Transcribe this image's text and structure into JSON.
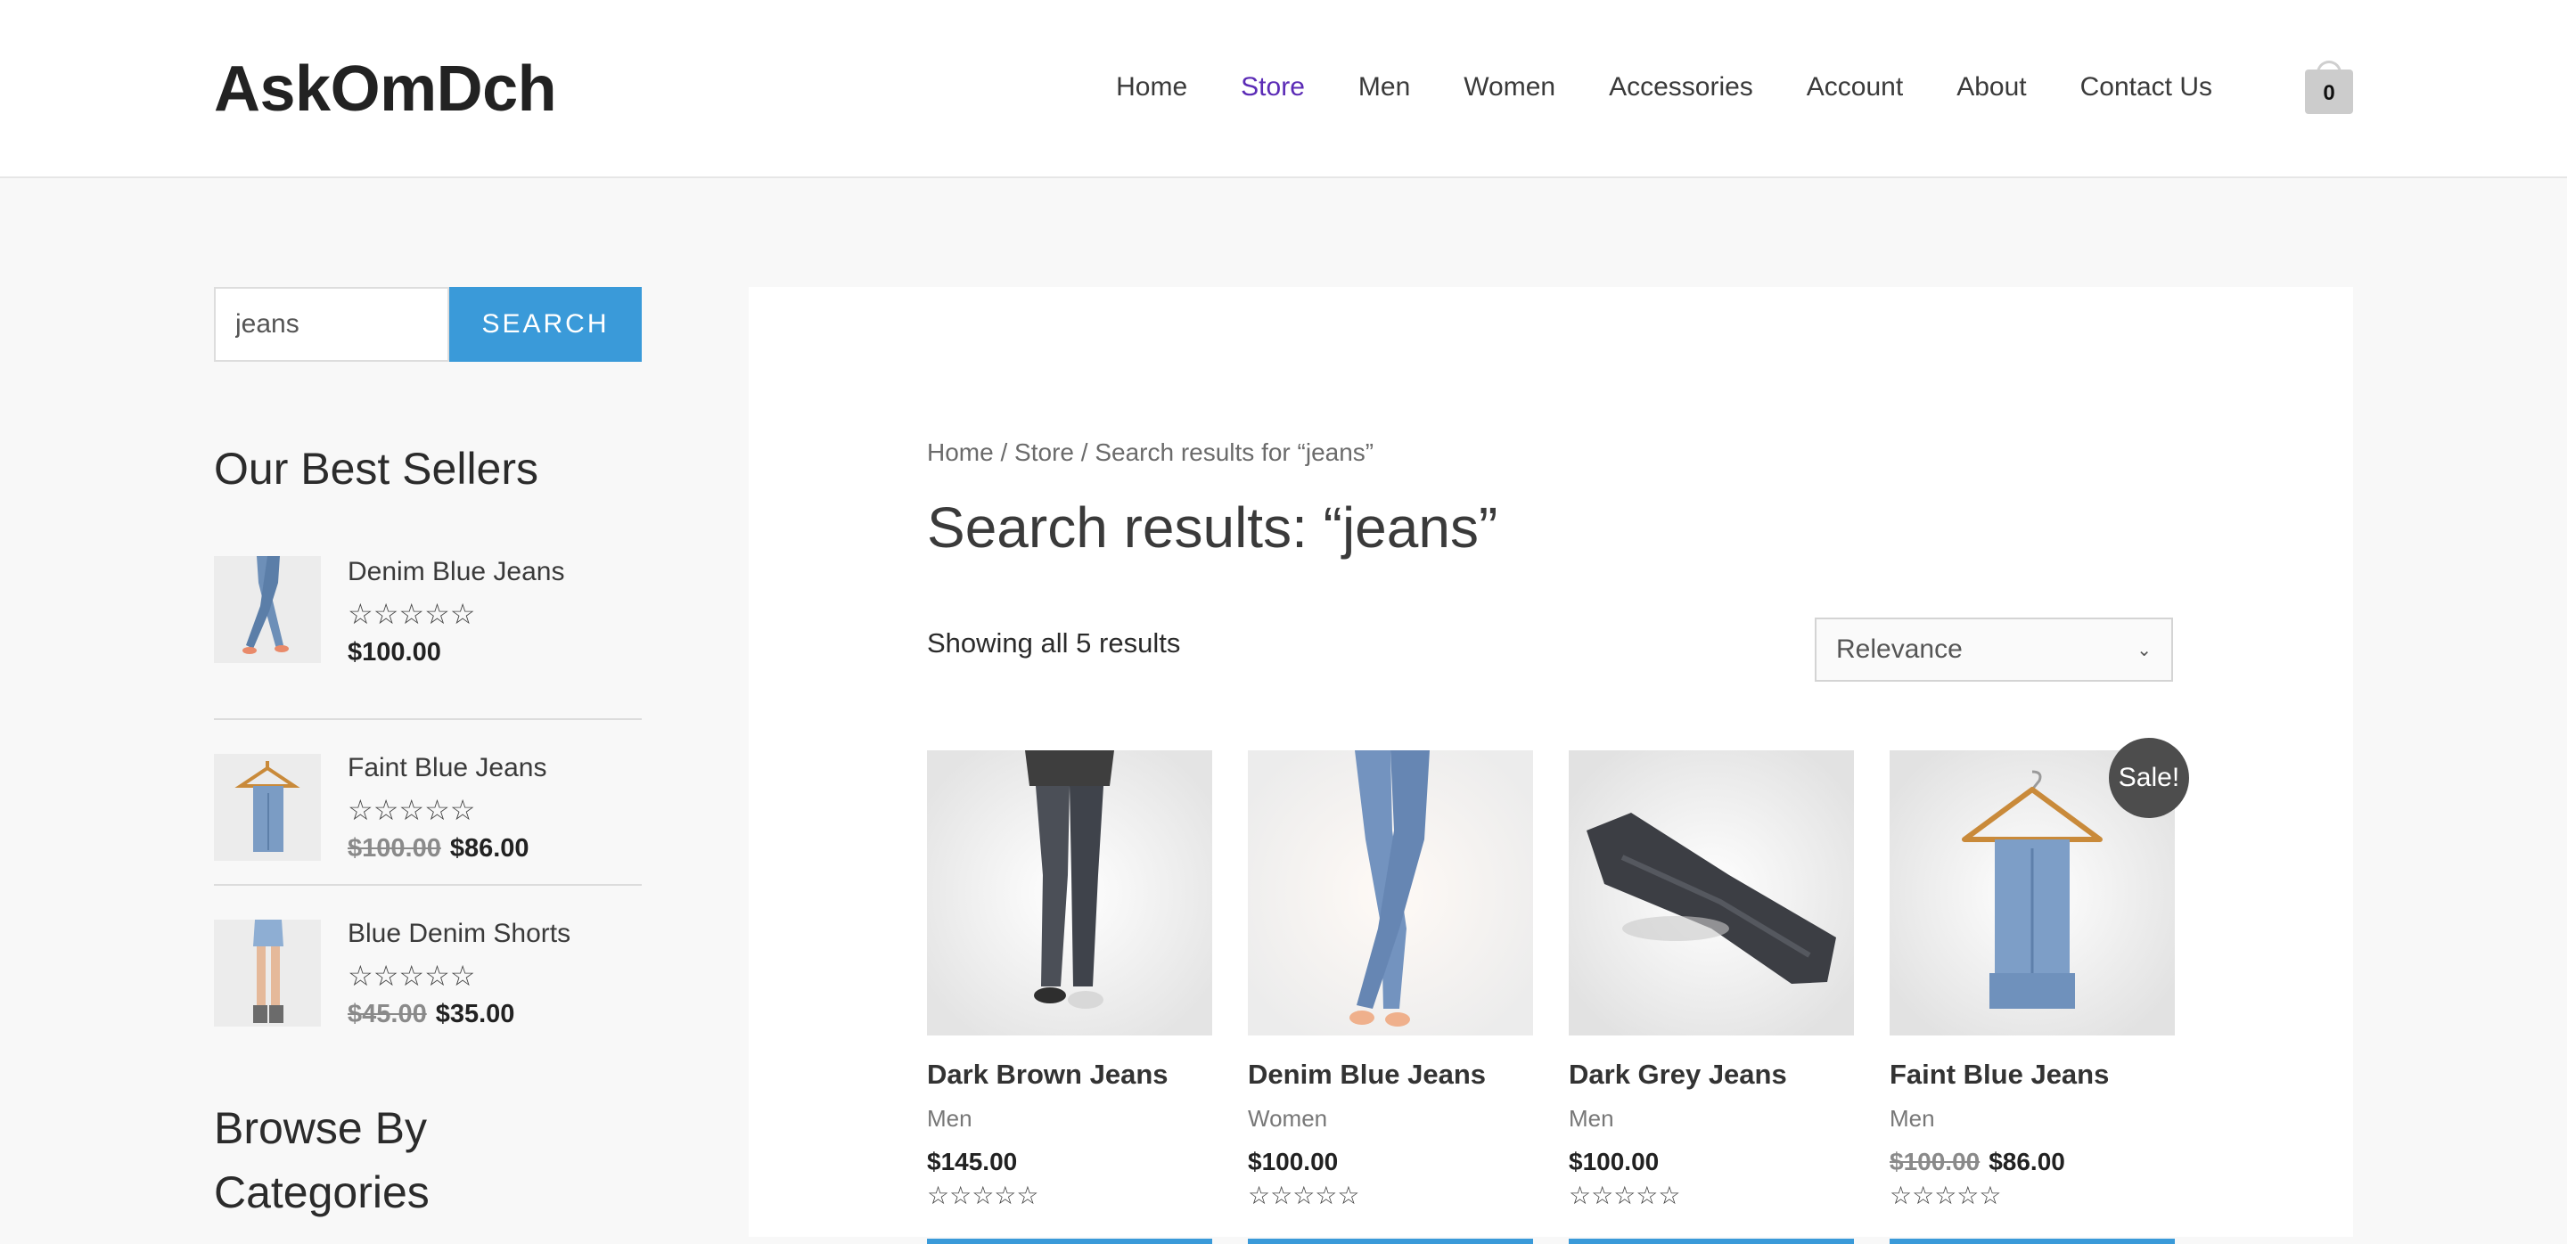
{
  "header": {
    "logo": "AskOmDch",
    "nav": [
      {
        "label": "Home",
        "active": false
      },
      {
        "label": "Store",
        "active": true
      },
      {
        "label": "Men",
        "active": false
      },
      {
        "label": "Women",
        "active": false
      },
      {
        "label": "Accessories",
        "active": false
      },
      {
        "label": "Account",
        "active": false
      },
      {
        "label": "About",
        "active": false
      },
      {
        "label": "Contact Us",
        "active": false
      }
    ],
    "cart_count": "0",
    "cart_icon": "shopping-bag-icon"
  },
  "sidebar": {
    "search": {
      "value": "jeans",
      "button_label": "SEARCH"
    },
    "best_sellers": {
      "title": "Our Best Sellers",
      "items": [
        {
          "name": "Denim Blue Jeans",
          "stars": "☆☆☆☆☆",
          "old_price": "",
          "price": "$100.00"
        },
        {
          "name": "Faint Blue Jeans",
          "stars": "☆☆☆☆☆",
          "old_price": "$100.00",
          "price": "$86.00"
        },
        {
          "name": "Blue Denim Shorts",
          "stars": "☆☆☆☆☆",
          "old_price": "$45.00",
          "price": "$35.00"
        }
      ]
    },
    "categories": {
      "title_line1": "Browse By",
      "title_line2": "Categories"
    }
  },
  "main": {
    "breadcrumb": {
      "home": "Home",
      "store": "Store",
      "current": "Search results for “jeans”",
      "sep": "/"
    },
    "title": "Search results: “jeans”",
    "result_count": "Showing all 5 results",
    "orderby": {
      "selected": "Relevance"
    },
    "products": [
      {
        "title": "Dark Brown Jeans",
        "category": "Men",
        "old_price": "",
        "price": "$145.00",
        "stars": "☆☆☆☆☆",
        "sale": ""
      },
      {
        "title": "Denim Blue Jeans",
        "category": "Women",
        "old_price": "",
        "price": "$100.00",
        "stars": "☆☆☆☆☆",
        "sale": ""
      },
      {
        "title": "Dark Grey Jeans",
        "category": "Men",
        "old_price": "",
        "price": "$100.00",
        "stars": "☆☆☆☆☆",
        "sale": ""
      },
      {
        "title": "Faint Blue Jeans",
        "category": "Men",
        "old_price": "$100.00",
        "price": "$86.00",
        "stars": "☆☆☆☆☆",
        "sale": "Sale!"
      }
    ]
  },
  "colors": {
    "accent": "#3a9ad9",
    "active_nav": "#5b2bb6",
    "badge": "#4d4d4d"
  }
}
